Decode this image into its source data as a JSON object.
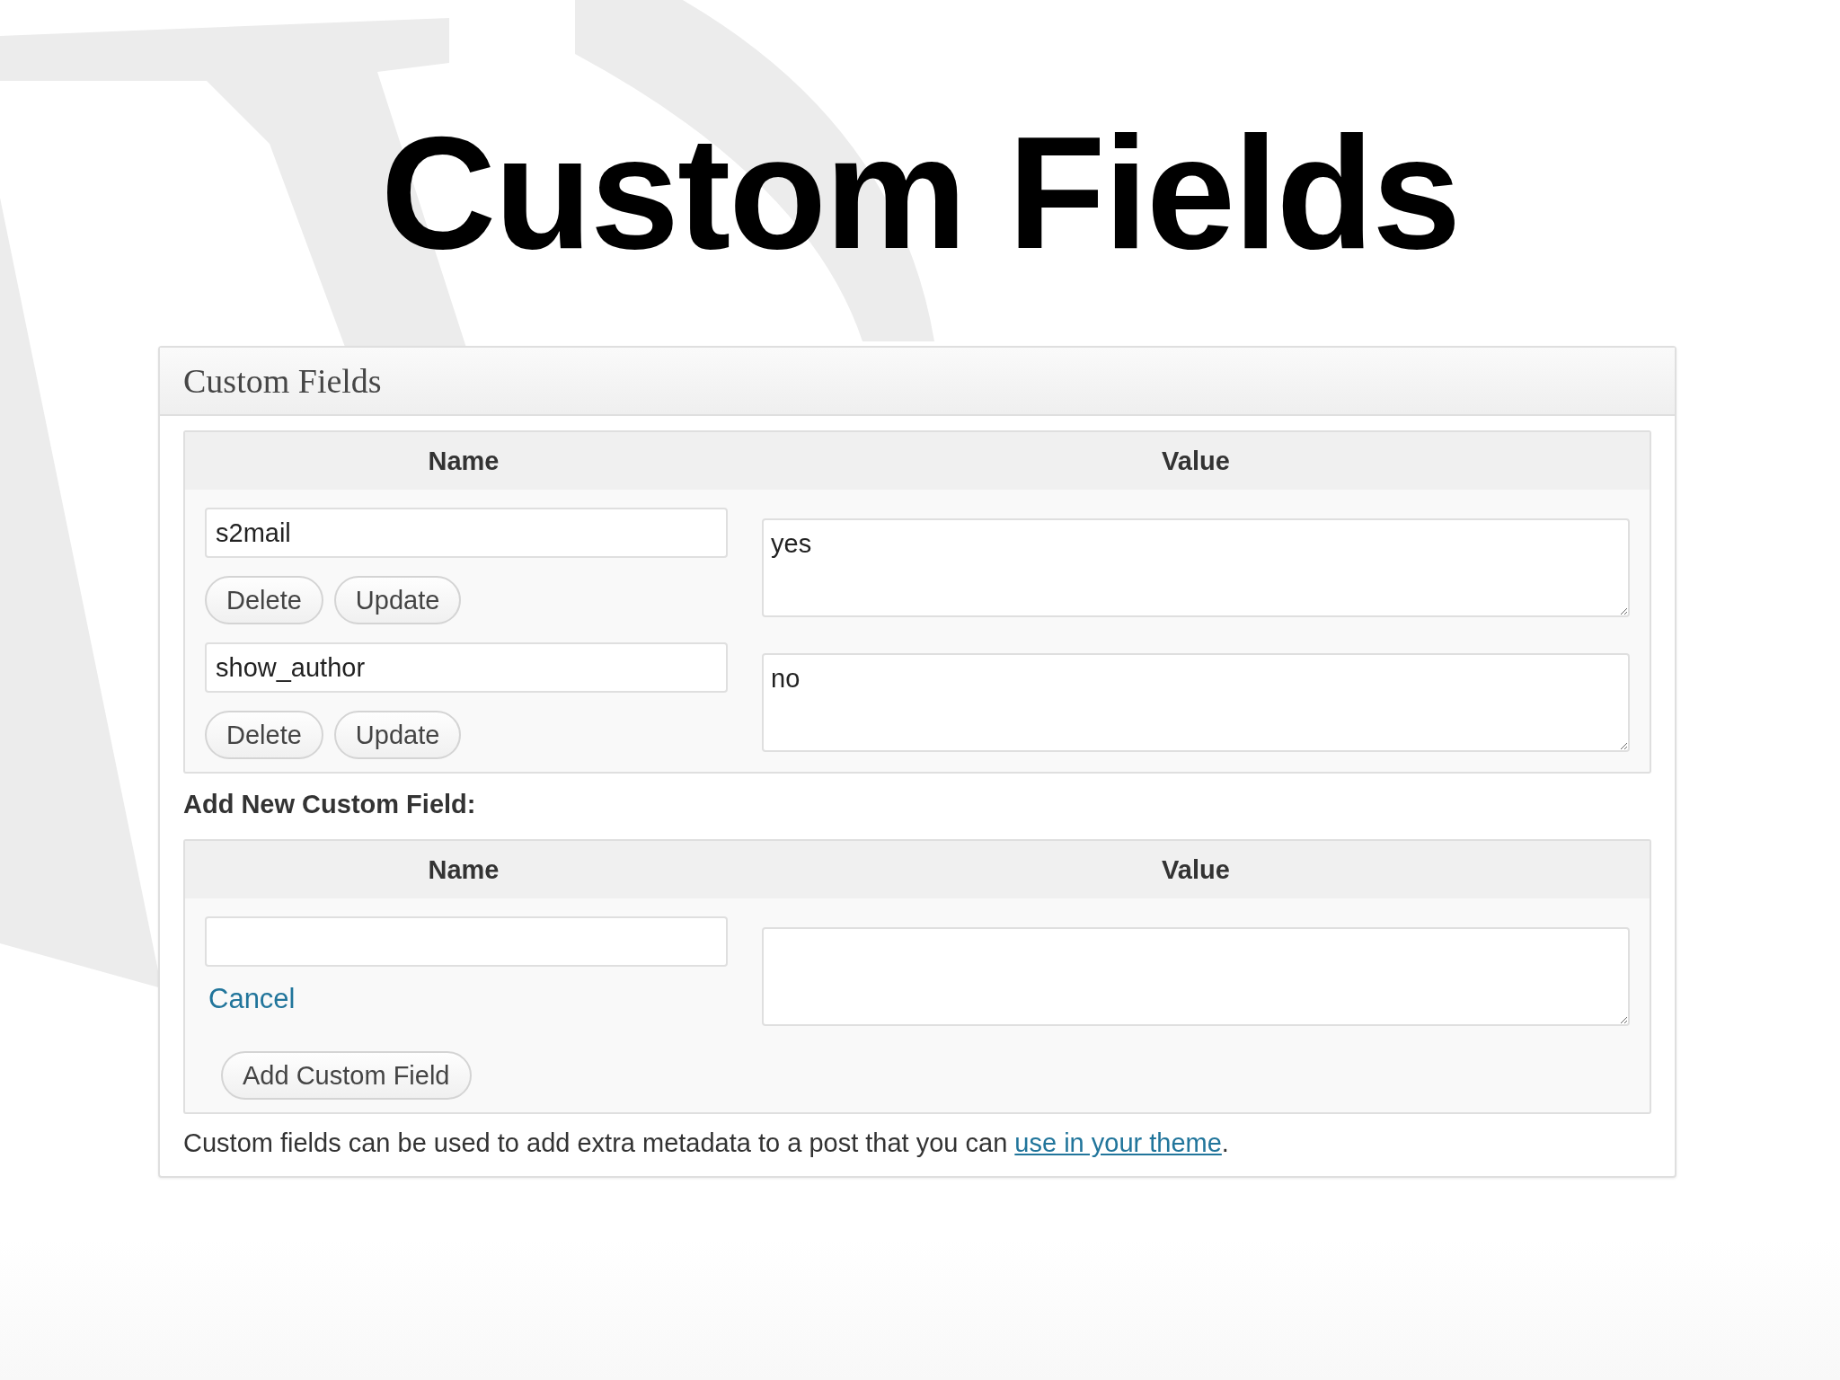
{
  "slide_title": "Custom Fields",
  "panel": {
    "title": "Custom Fields",
    "table": {
      "columns": [
        "Name",
        "Value"
      ],
      "rows": [
        {
          "name": "s2mail",
          "value": "yes",
          "buttons": [
            "Delete",
            "Update"
          ]
        },
        {
          "name": "show_author",
          "value": "no",
          "buttons": [
            "Delete",
            "Update"
          ]
        }
      ]
    },
    "add_new": {
      "heading": "Add New Custom Field:",
      "columns": [
        "Name",
        "Value"
      ],
      "cancel_link": "Cancel",
      "submit_button": "Add Custom Field"
    },
    "note": {
      "text": "Custom fields can be used to add extra metadata to a post that you can ",
      "link": "use in your theme",
      "suffix": "."
    }
  }
}
